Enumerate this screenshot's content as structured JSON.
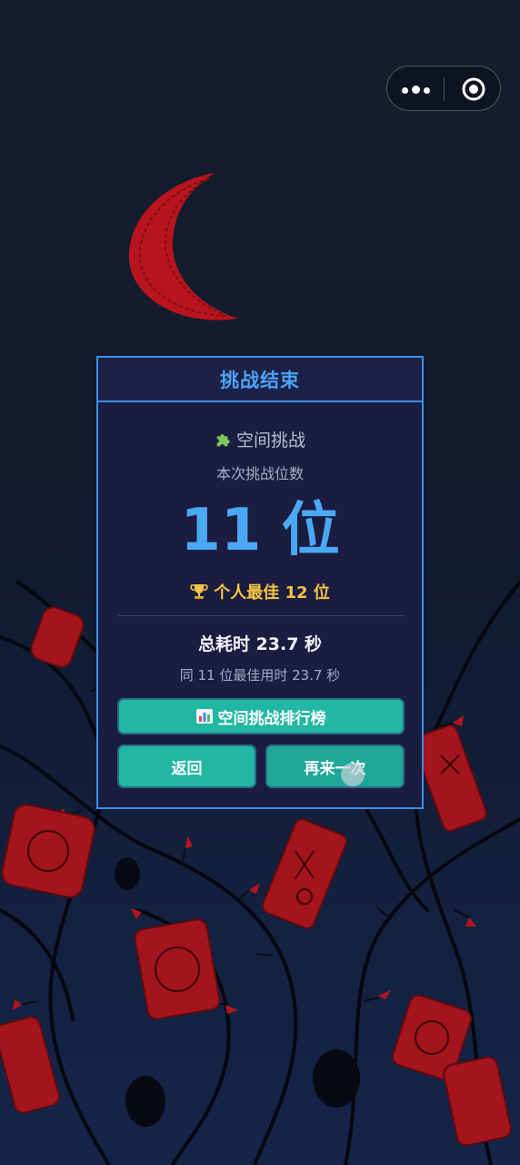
{
  "colors": {
    "background": "#0e1628",
    "accent_blue": "#4aa3f5",
    "dialog_bg": "#1a1d40",
    "button_teal": "#22b7a4",
    "gold": "#f6c443",
    "moon_red": "#b8141e"
  },
  "capsule": {
    "more_icon": "more-dots-icon",
    "close_icon": "target-close-icon"
  },
  "dialog": {
    "title": "挑战结束",
    "mode_icon": "puzzle-icon",
    "mode_name": "空间挑战",
    "subtitle": "本次挑战位数",
    "result": "11 位",
    "best_icon": "trophy-icon",
    "personal_best": "个人最佳 12 位",
    "total_time": "总耗时 23.7 秒",
    "same_digits_best": "同 11 位最佳用时 23.7 秒",
    "buttons": {
      "leaderboard": "空间挑战排行榜",
      "leaderboard_icon": "bar-chart-icon",
      "back": "返回",
      "retry": "再来一次"
    }
  }
}
